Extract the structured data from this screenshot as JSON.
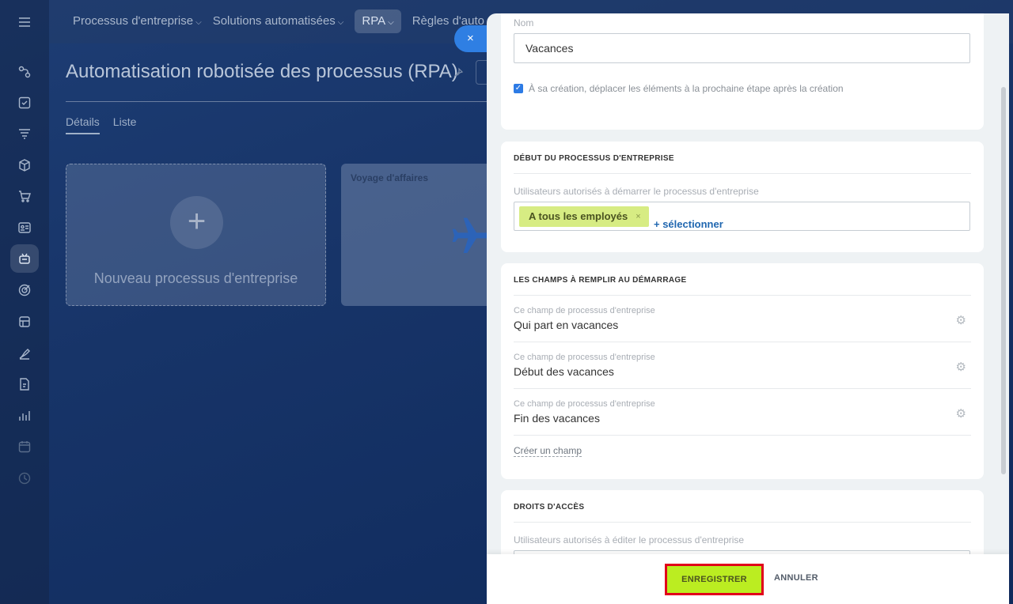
{
  "topnav": {
    "items": [
      {
        "label": "Processus d'entreprise",
        "chevron": "⌵"
      },
      {
        "label": "Solutions automatisées",
        "chevron": "⌵"
      },
      {
        "label": "RPA",
        "chevron": "⌵"
      },
      {
        "label": "Règles d'auto",
        "chevron": ""
      }
    ]
  },
  "page": {
    "title": "Automatisation robotisée des processus (RPA)",
    "tabs": [
      "Détails",
      "Liste"
    ]
  },
  "cards": {
    "new_label": "Nouveau processus d'entreprise",
    "plus": "+",
    "trip_label": "Voyage d'affaires"
  },
  "close_icon": "×",
  "panel": {
    "name_label": "Nom",
    "name_value": "Vacances",
    "move_checkbox_label": "À sa création, déplacer les éléments à la prochaine étape après la création",
    "checkbox_mark": "✓",
    "start_section": {
      "heading": "DÉBUT DU PROCESSUS D'ENTREPRISE",
      "users_label": "Utilisateurs autorisés à démarrer le processus d'entreprise",
      "chip": "A tous les employés",
      "chip_remove": "×",
      "select_link": "+ sélectionner"
    },
    "fields_section": {
      "heading": "LES CHAMPS À REMPLIR AU DÉMARRAGE",
      "fields": [
        {
          "meta": "Ce champ de processus d'entreprise",
          "value": "Qui part en vacances"
        },
        {
          "meta": "Ce champ de processus d'entreprise",
          "value": "Début des vacances"
        },
        {
          "meta": "Ce champ de processus d'entreprise",
          "value": "Fin des vacances"
        }
      ],
      "gear": "⚙",
      "create_link": "Créer un champ"
    },
    "access_section": {
      "heading": "DROITS D'ACCÈS",
      "users_label": "Utilisateurs autorisés à éditer le processus d'entreprise"
    },
    "footer": {
      "save": "ENREGISTRER",
      "cancel": "ANNULER"
    }
  },
  "colors": {
    "accent_blue": "#2f7fe3",
    "save_green": "#bbed21",
    "highlight_red": "#e1001b",
    "chip_green": "#d7ec83"
  }
}
